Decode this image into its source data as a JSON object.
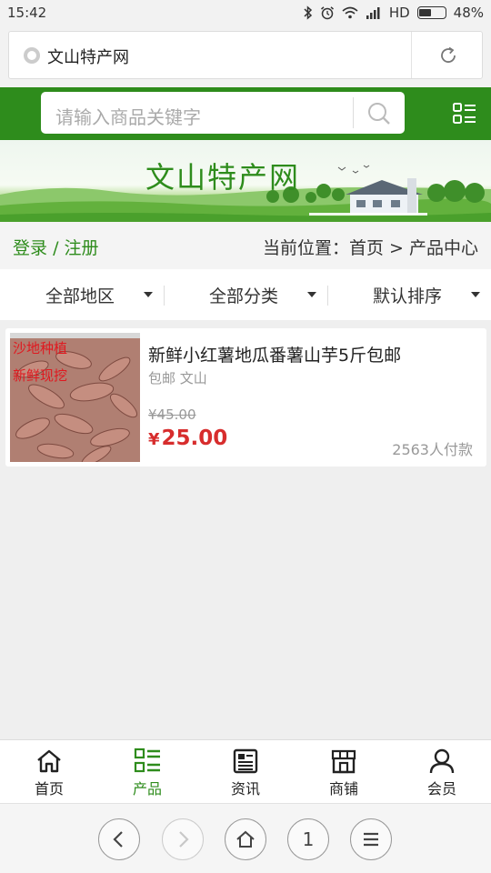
{
  "status_bar": {
    "time": "15:42",
    "network": "HD",
    "battery": "48%",
    "battery_level": 0.48
  },
  "browser": {
    "tab_title": "文山特产网",
    "icons": [
      "globe-icon",
      "reload-icon"
    ]
  },
  "header": {
    "search_placeholder": "请输入商品关键字",
    "icons": [
      "search-icon",
      "category-list-icon"
    ]
  },
  "banner": {
    "title": "文山特产网"
  },
  "account": {
    "login": "登录",
    "separator": "/",
    "register": "注册"
  },
  "breadcrumb": {
    "prefix": "当前位置：",
    "home": "首页",
    "sep": ">",
    "current": "产品中心"
  },
  "filters": [
    {
      "label": "全部地区"
    },
    {
      "label": "全部分类"
    },
    {
      "label": "默认排序"
    }
  ],
  "products": [
    {
      "title": "新鲜小红薯地瓜番薯山芋5斤包邮",
      "shipping": "包邮 文山",
      "original_price": "¥45.00",
      "currency": "¥",
      "price": "25.00",
      "sold": "2563人付款",
      "image_caption": [
        "沙地种植",
        "新鲜现挖"
      ]
    }
  ],
  "bottom_nav": [
    {
      "label": "首页",
      "icon": "home-icon",
      "active": false
    },
    {
      "label": "产品",
      "icon": "product-list-icon",
      "active": true
    },
    {
      "label": "资讯",
      "icon": "news-icon",
      "active": false
    },
    {
      "label": "商铺",
      "icon": "shop-icon",
      "active": false
    },
    {
      "label": "会员",
      "icon": "member-icon",
      "active": false
    }
  ],
  "browser_nav": {
    "tab_count": "1",
    "icons": [
      "back-icon",
      "forward-icon",
      "home-icon",
      "tabs-icon",
      "menu-icon"
    ]
  },
  "colors": {
    "brand_green": "#2e8c1c",
    "price_red": "#d72d2d"
  }
}
